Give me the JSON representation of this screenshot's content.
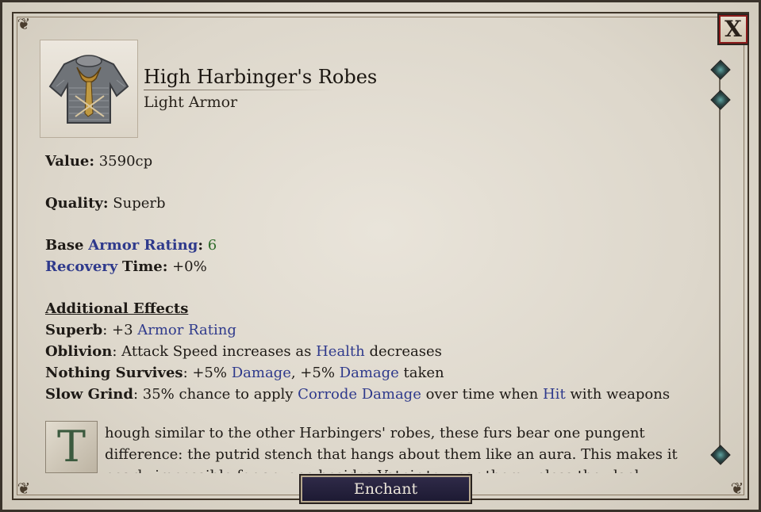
{
  "item": {
    "name": "High Harbinger's Robes",
    "type": "Light Armor",
    "icon": "chainmail-robe-icon"
  },
  "stats": {
    "value_label": "Value:",
    "value": "3590cp",
    "quality_label": "Quality:",
    "quality": "Superb",
    "base_label": "Base",
    "armor_rating_label": "Armor Rating",
    "armor_rating_value": "6",
    "recovery_label": "Recovery",
    "recovery_time_label": "Time:",
    "recovery_value": "+0%"
  },
  "effects": {
    "heading": "Additional Effects",
    "superb": {
      "name": "Superb",
      "pre": ": +3 ",
      "kw": "Armor Rating"
    },
    "oblivion": {
      "name": "Oblivion",
      "pre": ": Attack Speed increases as ",
      "kw": "Health",
      "post": " decreases"
    },
    "nothing": {
      "name": "Nothing Survives",
      "pre": ": +5% ",
      "kw1": "Damage",
      "mid": ", +5% ",
      "kw2": "Damage",
      "post": " taken"
    },
    "slow": {
      "name": "Slow Grind",
      "pre": ": 35% chance to apply ",
      "kw1": "Corrode Damage",
      "mid": " over time when ",
      "kw2": "Hit",
      "post": " with weapons"
    }
  },
  "description": {
    "dropcap": "T",
    "text": "hough similar to the other Harbingers' robes, these furs bear one pungent difference: the putrid stench that hangs about them like an aura. This makes it nearly impossible for anyone besides Vatnir to wear them unless they lack faculties"
  },
  "buttons": {
    "close": "X",
    "enchant": "Enchant"
  },
  "colors": {
    "keyword": "#2f3a8c",
    "positive_number": "#2e6b2a",
    "close_accent": "#8b1a1a",
    "button_bg": "#1d1a33"
  }
}
